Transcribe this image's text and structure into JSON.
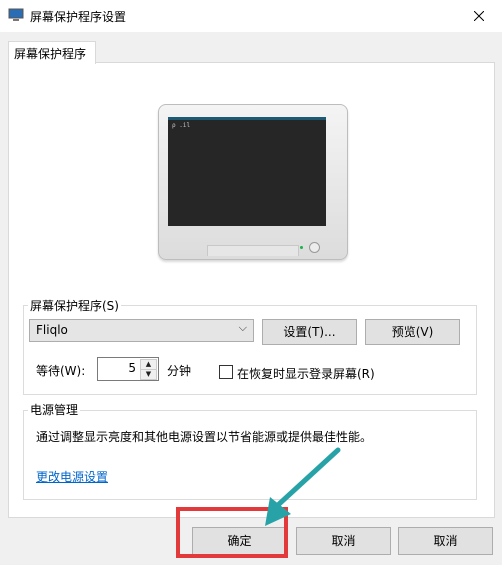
{
  "window": {
    "title": "屏幕保护程序设置"
  },
  "tab": {
    "label": "屏幕保护程序"
  },
  "preview_screen_text": "ρ .il",
  "screensaver_group": {
    "legend": "屏幕保护程序(S)",
    "selected": "Fliqlo",
    "settings_button": "设置(T)...",
    "preview_button": "预览(V)",
    "wait_label": "等待(W):",
    "wait_value": "5",
    "minutes_label": "分钟",
    "resume_checkbox_label": "在恢复时显示登录屏幕(R)",
    "resume_checked": false
  },
  "power_group": {
    "legend": "电源管理",
    "description": "通过调整显示亮度和其他电源设置以节省能源或提供最佳性能。",
    "link": "更改电源设置"
  },
  "buttons": {
    "ok": "确定",
    "cancel": "取消",
    "apply": "取消"
  },
  "colors": {
    "highlight": "#e23a3a",
    "arrow": "#27a3a8",
    "link": "#0066cc"
  }
}
